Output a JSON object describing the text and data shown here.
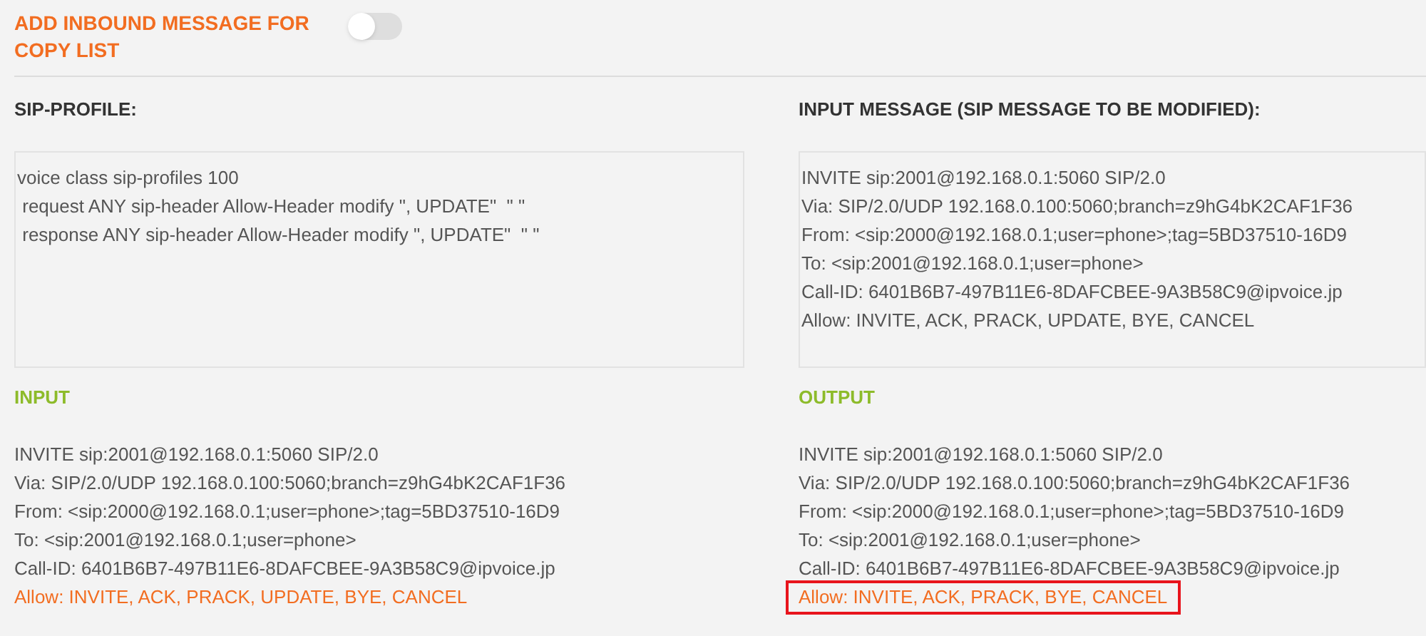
{
  "toggle": {
    "label": "ADD INBOUND MESSAGE FOR COPY LIST",
    "on": false
  },
  "sip_profile": {
    "heading": "SIP-PROFILE:",
    "lines": [
      "voice class sip-profiles 100",
      " request ANY sip-header Allow-Header modify \", UPDATE\"  \" \"",
      " response ANY sip-header Allow-Header modify \", UPDATE\"  \" \""
    ]
  },
  "input_message": {
    "heading": "INPUT MESSAGE (SIP MESSAGE TO BE MODIFIED):",
    "lines": [
      "INVITE sip:2001@192.168.0.1:5060 SIP/2.0",
      "Via: SIP/2.0/UDP 192.168.0.100:5060;branch=z9hG4bK2CAF1F36",
      "From: <sip:2000@192.168.0.1;user=phone>;tag=5BD37510-16D9",
      "To: <sip:2001@192.168.0.1;user=phone>",
      "Call-ID: 6401B6B7-497B11E6-8DAFCBEE-9A3B58C9@ipvoice.jp",
      "Allow: INVITE, ACK, PRACK, UPDATE, BYE, CANCEL"
    ]
  },
  "input": {
    "heading": "INPUT",
    "lines": [
      {
        "text": "INVITE sip:2001@192.168.0.1:5060 SIP/2.0",
        "highlighted": false,
        "boxed": false
      },
      {
        "text": "Via: SIP/2.0/UDP 192.168.0.100:5060;branch=z9hG4bK2CAF1F36",
        "highlighted": false,
        "boxed": false
      },
      {
        "text": "From: <sip:2000@192.168.0.1;user=phone>;tag=5BD37510-16D9",
        "highlighted": false,
        "boxed": false
      },
      {
        "text": "To: <sip:2001@192.168.0.1;user=phone>",
        "highlighted": false,
        "boxed": false
      },
      {
        "text": "Call-ID: 6401B6B7-497B11E6-8DAFCBEE-9A3B58C9@ipvoice.jp",
        "highlighted": false,
        "boxed": false
      },
      {
        "text": "Allow: INVITE, ACK, PRACK, UPDATE, BYE, CANCEL",
        "highlighted": true,
        "boxed": false
      }
    ]
  },
  "output": {
    "heading": "OUTPUT",
    "lines": [
      {
        "text": "INVITE sip:2001@192.168.0.1:5060 SIP/2.0",
        "highlighted": false,
        "boxed": false
      },
      {
        "text": "Via: SIP/2.0/UDP 192.168.0.100:5060;branch=z9hG4bK2CAF1F36",
        "highlighted": false,
        "boxed": false
      },
      {
        "text": "From: <sip:2000@192.168.0.1;user=phone>;tag=5BD37510-16D9",
        "highlighted": false,
        "boxed": false
      },
      {
        "text": "To: <sip:2001@192.168.0.1;user=phone>",
        "highlighted": false,
        "boxed": false
      },
      {
        "text": "Call-ID: 6401B6B7-497B11E6-8DAFCBEE-9A3B58C9@ipvoice.jp",
        "highlighted": false,
        "boxed": false
      },
      {
        "text": "Allow: INVITE, ACK, PRACK, BYE, CANCEL",
        "highlighted": true,
        "boxed": true
      }
    ]
  }
}
